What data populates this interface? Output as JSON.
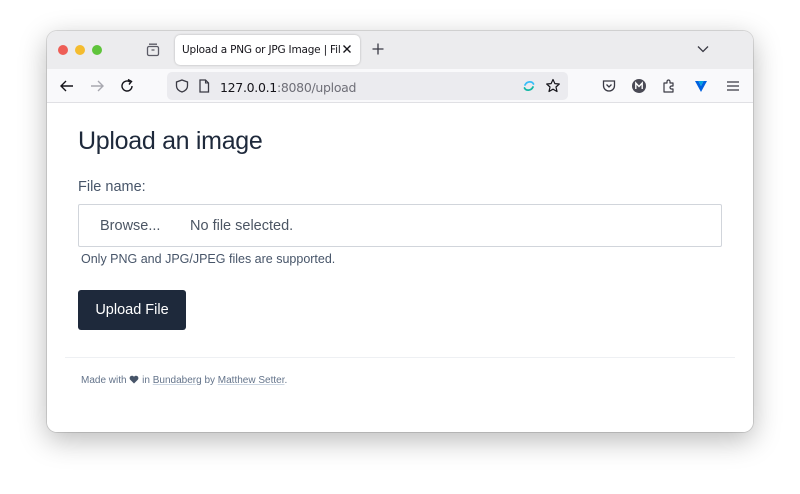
{
  "browser": {
    "tab": {
      "title": "Upload a PNG or JPG Image | File Uploader"
    },
    "address_bar": {
      "host": "127.0.0.1",
      "path": ":8080/upload"
    },
    "icons": {
      "tabs_list": "tabs-list-icon",
      "tab_close": "close-icon",
      "new_tab": "plus-icon",
      "list_all_tabs": "chevron-down-icon",
      "back": "back-arrow-icon",
      "forward": "forward-arrow-icon",
      "reload": "reload-icon",
      "tracking_protection": "shield-icon",
      "page_info": "page-icon",
      "extension_in_url": "extension-icon",
      "bookmark": "star-icon",
      "pocket": "pocket-icon",
      "account": "account-m-icon",
      "extensions": "puzzle-icon",
      "vpn": "vpn-icon",
      "menu": "hamburger-menu-icon"
    },
    "colors": {
      "close_button": "#ee5e56",
      "minimize_button": "#f4bc2f",
      "maximize_button": "#5fc43b"
    }
  },
  "page": {
    "heading": "Upload an image",
    "form": {
      "file_label": "File name:",
      "browse_label": "Browse...",
      "file_status": "No file selected.",
      "help_text": "Only PNG and JPG/JPEG files are supported.",
      "submit_label": "Upload File"
    },
    "footer": {
      "made_with": "Made with",
      "in_text": "in",
      "location_link": "Bundaberg",
      "by_text": "by",
      "author_link": "Matthew Setter",
      "end": "."
    },
    "colors": {
      "primary": "#1e293b",
      "text_muted": "#64748b"
    }
  }
}
